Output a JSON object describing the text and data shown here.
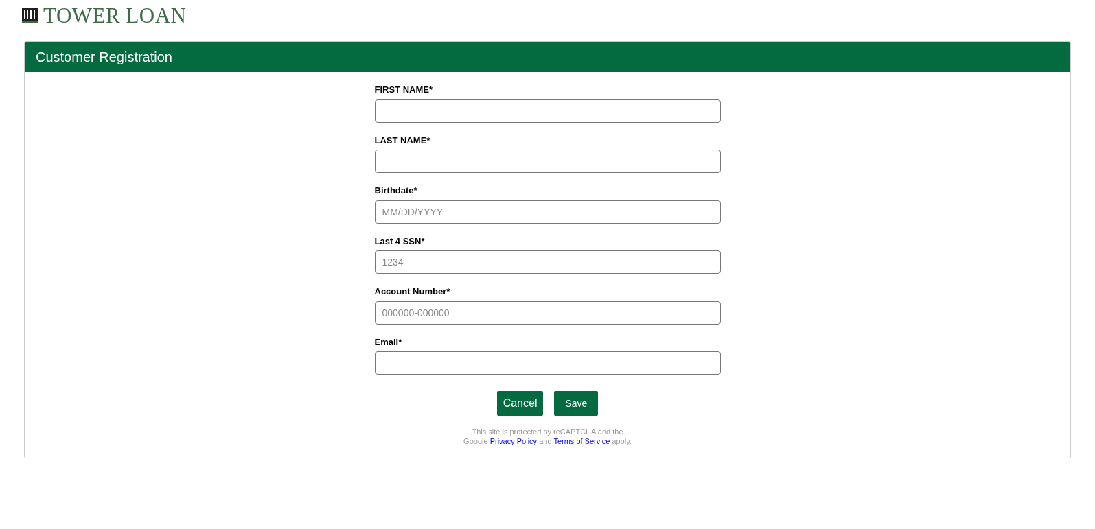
{
  "logo": {
    "text": "TOWER LOAN"
  },
  "card": {
    "title": "Customer Registration"
  },
  "fields": [
    {
      "label": "FIRST NAME*"
    },
    {
      "label": "LAST NAME*"
    },
    {
      "label": "Birthdate*",
      "placeholder": "MM/DD/YYYY"
    },
    {
      "label": "Last 4 SSN*",
      "placeholder": "1234"
    },
    {
      "label": "Account Number*",
      "placeholder": "000000-000000"
    },
    {
      "label": "Email*"
    }
  ],
  "buttons": [
    {
      "label": "Cancel",
      "kind": "cancel"
    },
    {
      "label": "Save",
      "kind": "save"
    }
  ],
  "notice": {
    "line_1": "This site is protected by reCAPTCHA and the",
    "before": "Google",
    "privacy_link": "Privacy Policy",
    "middle": "and",
    "terms_link": "Terms of Service",
    "after": "apply."
  }
}
